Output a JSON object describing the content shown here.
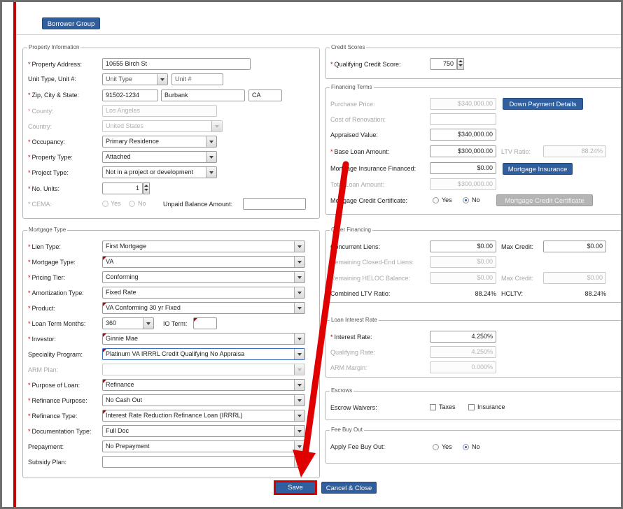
{
  "top": {
    "borrower_group": "Borrower Group"
  },
  "property": {
    "legend": "Property Information",
    "address_label": "Property Address:",
    "address": "10655 Birch St",
    "unit_label": "Unit Type, Unit #:",
    "unit_type": "Unit Type",
    "unit_num": "Unit #",
    "zip_label": "Zip, City & State:",
    "zip": "91502-1234",
    "city": "Burbank",
    "state": "CA",
    "county_label": "County:",
    "county": "Los Angeles",
    "country_label": "Country:",
    "country": "United States",
    "occupancy_label": "Occupancy:",
    "occupancy": "Primary Residence",
    "ptype_label": "Property Type:",
    "ptype": "Attached",
    "project_label": "Project Type:",
    "project": "Not in a project or development",
    "units_label": "No. Units:",
    "units": "1",
    "cema_label": "CEMA:",
    "yes": "Yes",
    "no": "No",
    "unpaid_label": "Unpaid Balance Amount:"
  },
  "mortgage": {
    "legend": "Mortgage Type",
    "lien_label": "Lien Type:",
    "lien": "First Mortgage",
    "mtype_label": "Mortgage Type:",
    "mtype": "VA",
    "tier_label": "Pricing Tier:",
    "tier": "Conforming",
    "amort_label": "Amortization Type:",
    "amort": "Fixed Rate",
    "product_label": "Product:",
    "product": "VA Conforming 30 yr Fixed",
    "term_label": "Loan Term Months:",
    "term": "360",
    "io_label": "IO Term:",
    "investor_label": "Investor:",
    "investor": "Ginnie Mae",
    "special_label": "Speciality Program:",
    "special": "Platinum VA IRRRL Credit Qualifying No Appraisa",
    "arm_label": "ARM Plan:",
    "purpose_label": "Purpose of Loan:",
    "purpose": "Refinance",
    "refi_purpose_label": "Refinance Purpose:",
    "refi_purpose": "No Cash Out",
    "refi_type_label": "Refinance Type:",
    "refi_type": "Interest Rate Reduction Refinance Loan (IRRRL)",
    "doc_label": "Documentation Type:",
    "doc": "Full Doc",
    "prepay_label": "Prepayment:",
    "prepay": "No Prepayment",
    "subsidy_label": "Subsidy Plan:"
  },
  "credit": {
    "legend": "Credit Scores",
    "score_label": "Qualifying Credit Score:",
    "score": "750"
  },
  "financing": {
    "legend": "Financing Terms",
    "price_label": "Purchase Price:",
    "price": "$340,000.00",
    "dp_button": "Down Payment Details",
    "reno_label": "Cost of Renovation:",
    "appraised_label": "Appraised Value:",
    "appraised": "$340,000.00",
    "base_label": "Base Loan Amount:",
    "base": "$300,000.00",
    "ltv_label": "LTV Ratio:",
    "ltv": "88.24%",
    "mi_label": "Mortgage Insurance Financed:",
    "mi": "$0.00",
    "mi_button": "Mortgage Insurance",
    "total_label": "Total Loan Amount:",
    "total": "$300,000.00",
    "mcc_label": "Mortgage Credit Certificate:",
    "yes": "Yes",
    "no": "No",
    "mcc_button": "Mortgage Credit Certificate"
  },
  "other": {
    "legend": "Other Financing",
    "concurrent_label": "Concurrent Liens:",
    "concurrent": "$0.00",
    "max_credit_label": "Max Credit:",
    "max_credit": "$0.00",
    "closed_label": "Remaining Closed-End Liens:",
    "closed": "$0.00",
    "heloc_label": "Remaining HELOC Balance:",
    "heloc": "$0.00",
    "max_credit2_label": "Max Credit:",
    "max_credit2": "$0.00",
    "cltv_label": "Combined LTV Ratio:",
    "cltv": "88.24%",
    "hcltv_label": "HCLTV:",
    "hcltv": "88.24%"
  },
  "rate": {
    "legend": "Loan Interest Rate",
    "interest_label": "Interest Rate:",
    "interest": "4.250%",
    "qual_label": "Qualifying Rate:",
    "qual": "4.250%",
    "margin_label": "ARM Margin:",
    "margin": "0.000%"
  },
  "escrows": {
    "legend": "Escrows",
    "waivers_label": "Escrow Waivers:",
    "taxes": "Taxes",
    "insurance": "Insurance"
  },
  "fee": {
    "legend": "Fee Buy Out",
    "apply_label": "Apply Fee Buy Out:",
    "yes": "Yes",
    "no": "No"
  },
  "footer": {
    "save": "Save",
    "cancel": "Cancel & Close"
  },
  "colors": {
    "accent": "#2f5f9e",
    "highlight": "#d40000",
    "arrow": "#e00000"
  }
}
